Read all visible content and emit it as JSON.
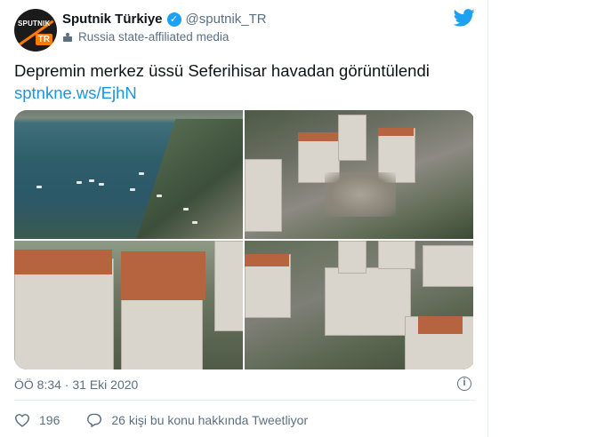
{
  "author": {
    "display_name": "Sputnik Türkiye",
    "handle": "@sputnik_TR",
    "affiliation": "Russia state-affiliated media",
    "avatar_text": "SPUTNIK",
    "avatar_badge": "TR"
  },
  "tweet": {
    "text": "Depremin merkez üssü Seferihisar havadan görüntülendi",
    "link": "sptnkne.ws/EjhN"
  },
  "meta": {
    "timestamp": "ÖÖ 8:34 · 31 Eki 2020"
  },
  "actions": {
    "likes": "196",
    "conversation": "26 kişi bu konu hakkında Tweetliyor"
  },
  "colors": {
    "link": "#1b95e0",
    "verified": "#1da1f2",
    "secondary_text": "#5b7083",
    "brand_orange": "#ff7a00"
  },
  "icons": [
    "verified-icon",
    "state-media-icon",
    "twitter-bird-icon",
    "info-icon",
    "heart-icon",
    "reply-icon"
  ]
}
